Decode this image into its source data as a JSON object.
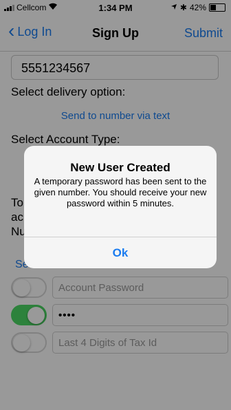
{
  "status_bar": {
    "carrier": "Cellcom",
    "time": "1:34 PM",
    "battery": "42%",
    "battery_level": 0.42
  },
  "nav": {
    "back_label": "Log In",
    "title": "Sign Up",
    "submit_label": "Submit"
  },
  "form": {
    "phone_value": "5551234567",
    "delivery_label": "Select delivery option:",
    "delivery_link": "Send to number via text",
    "account_type_label": "Select Account Type:",
    "partial_lines": [
      "To",
      "ac",
      "Nu"
    ],
    "partial_link": "Se",
    "rows": [
      {
        "placeholder": "Account Password",
        "value": "",
        "on": false
      },
      {
        "placeholder": "",
        "value": "••••",
        "on": true
      },
      {
        "placeholder": "Last 4 Digits of Tax Id",
        "value": "",
        "on": false
      }
    ]
  },
  "alert": {
    "title": "New User Created",
    "message": "A temporary password has been sent to the given number. You should receive your new password within 5 minutes.",
    "ok_label": "Ok"
  },
  "colors": {
    "accent": "#1a7cf0",
    "toggle_on": "#4cd964"
  }
}
